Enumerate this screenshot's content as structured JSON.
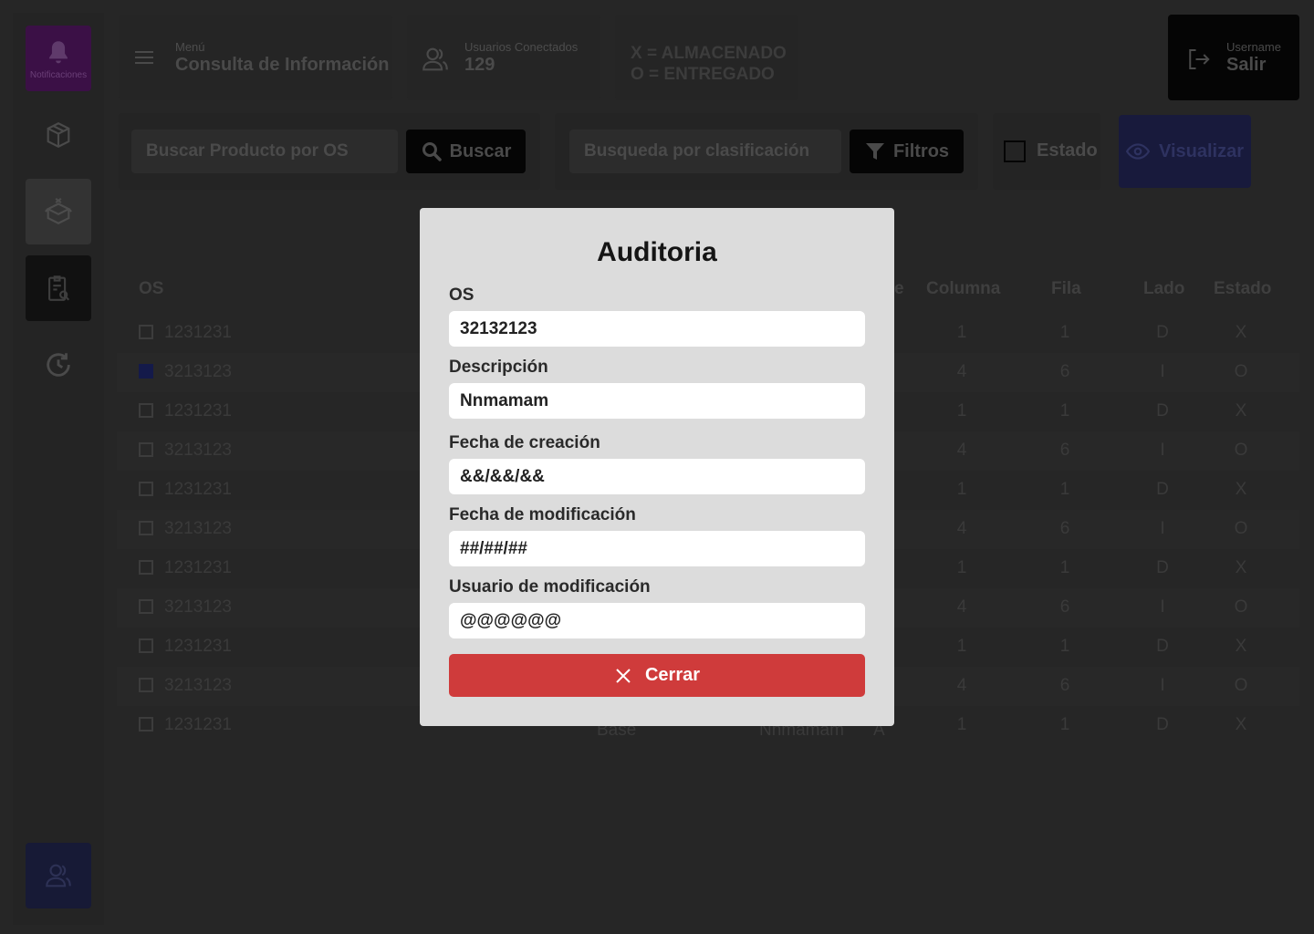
{
  "sidebar": {
    "notifications_label": "Notificaciones"
  },
  "header": {
    "menu_small": "Menú",
    "menu_title": "Consulta de Información",
    "users_small": "Usuarios Conectados",
    "users_count": "129",
    "legend_x": "X = ALMACENADO",
    "legend_o": "O = ENTREGADO",
    "username_small": "Username",
    "logout_label": "Salir"
  },
  "filters": {
    "search_placeholder": "Buscar Producto por OS",
    "search_button": "Buscar",
    "classification_placeholder": "Busqueda por clasificación",
    "filters_button": "Filtros",
    "status_checkbox_label": "Estado",
    "visualize_button": "Visualizar"
  },
  "table": {
    "headers": {
      "os": "OS",
      "col5_partial": "e",
      "columna": "Columna",
      "fila": "Fila",
      "lado": "Lado",
      "estado": "Estado"
    },
    "rows": [
      {
        "os": "1231231",
        "columna": "1",
        "fila": "1",
        "lado": "D",
        "estado": "X",
        "checked": false
      },
      {
        "os": "3213123",
        "columna": "4",
        "fila": "6",
        "lado": "I",
        "estado": "O",
        "checked": true
      },
      {
        "os": "1231231",
        "columna": "1",
        "fila": "1",
        "lado": "D",
        "estado": "X",
        "checked": false
      },
      {
        "os": "3213123",
        "columna": "4",
        "fila": "6",
        "lado": "I",
        "estado": "O",
        "checked": false
      },
      {
        "os": "1231231",
        "columna": "1",
        "fila": "1",
        "lado": "D",
        "estado": "X",
        "checked": false
      },
      {
        "os": "3213123",
        "columna": "4",
        "fila": "6",
        "lado": "I",
        "estado": "O",
        "checked": false
      },
      {
        "os": "1231231",
        "columna": "1",
        "fila": "1",
        "lado": "D",
        "estado": "X",
        "checked": false
      },
      {
        "os": "3213123",
        "columna": "4",
        "fila": "6",
        "lado": "I",
        "estado": "O",
        "checked": false
      },
      {
        "os": "1231231",
        "columna": "1",
        "fila": "1",
        "lado": "D",
        "estado": "X",
        "checked": false
      },
      {
        "os": "3213123",
        "columna": "4",
        "fila": "6",
        "lado": "I",
        "estado": "O",
        "checked": false
      },
      {
        "os": "1231231",
        "columna": "1",
        "fila": "1",
        "lado": "D",
        "estado": "X",
        "checked": false,
        "partial_a": "Base",
        "partial_b": "Nnmamam",
        "partial_c": "A"
      }
    ]
  },
  "modal": {
    "title": "Auditoria",
    "fields": [
      {
        "label": "OS",
        "value": "32132123"
      },
      {
        "label": "Descripción",
        "value": "Nnmamam"
      },
      {
        "label": "Fecha de creación",
        "value": "&&/&&/&&"
      },
      {
        "label": "Fecha de modificación",
        "value": "##/##/##"
      },
      {
        "label": "Usuario de modificación",
        "value": "@@@@@@"
      }
    ],
    "close_button": "Cerrar"
  },
  "colors": {
    "accent_purple": "#3b1046",
    "accent_blue": "#181a3c",
    "danger_red": "#cf3b3b"
  }
}
